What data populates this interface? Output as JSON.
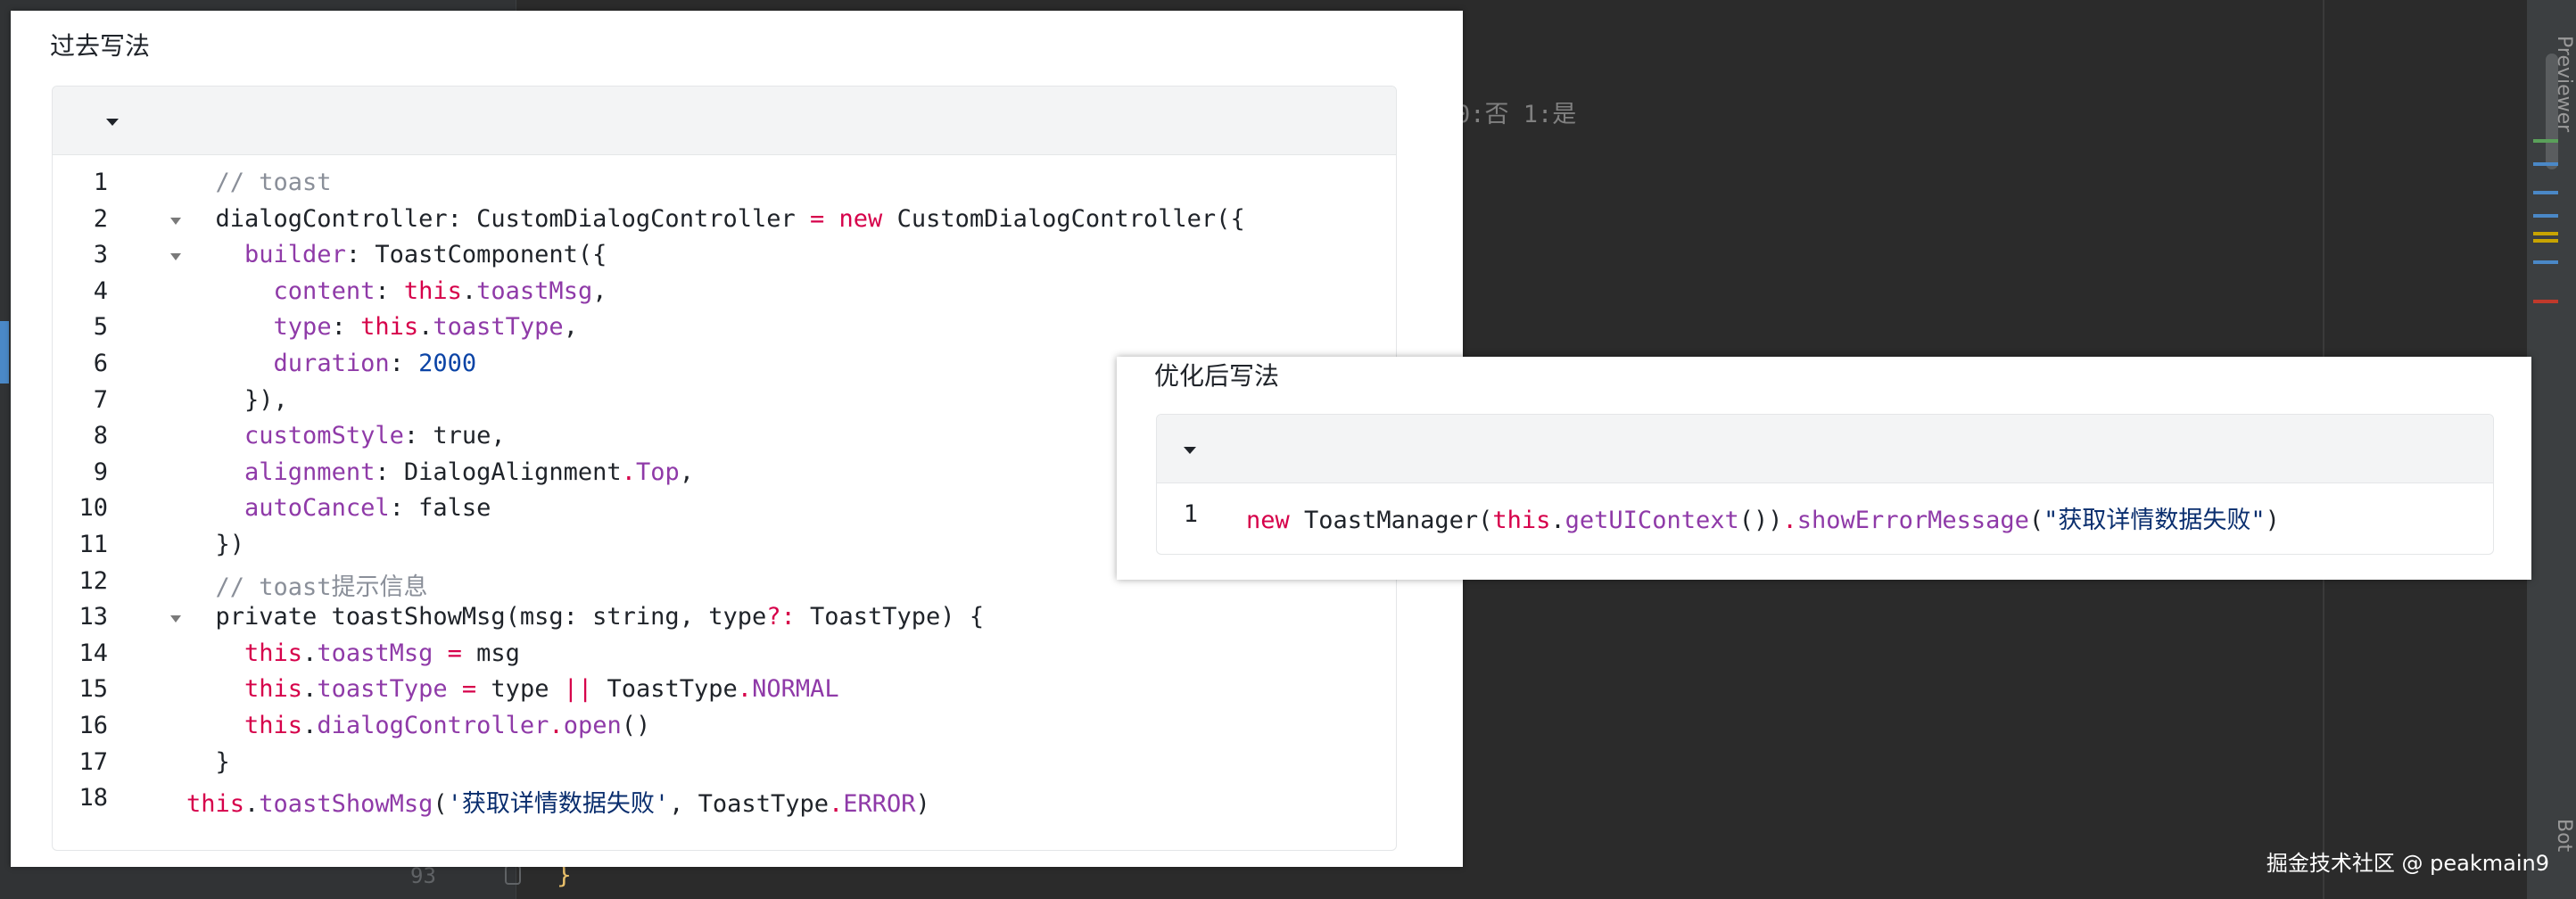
{
  "ide": {
    "bottom_line_number": "93",
    "bottom_brace": "}",
    "comment_fragment": "0:否 1:是",
    "right_sidebar_label": "Previewer",
    "right_sidebar_label2": "Bot"
  },
  "left_panel": {
    "title": "过去写法",
    "lines": [
      {
        "n": "1",
        "fold": false,
        "indent": "  ",
        "tokens": [
          {
            "t": "// toast",
            "c": "com"
          }
        ]
      },
      {
        "n": "2",
        "fold": true,
        "indent": "  ",
        "tokens": [
          {
            "t": "dialogController: CustomDialogController ",
            "c": "plain"
          },
          {
            "t": "=",
            "c": "kw"
          },
          {
            "t": " ",
            "c": "plain"
          },
          {
            "t": "new",
            "c": "kw"
          },
          {
            "t": " CustomDialogController({",
            "c": "plain"
          }
        ]
      },
      {
        "n": "3",
        "fold": true,
        "indent": "    ",
        "tokens": [
          {
            "t": "builder",
            "c": "prop"
          },
          {
            "t": ": ToastComponent({",
            "c": "plain"
          }
        ]
      },
      {
        "n": "4",
        "fold": false,
        "indent": "      ",
        "tokens": [
          {
            "t": "content",
            "c": "prop"
          },
          {
            "t": ": ",
            "c": "plain"
          },
          {
            "t": "this",
            "c": "kw"
          },
          {
            "t": ".",
            "c": "plain"
          },
          {
            "t": "toastMsg",
            "c": "prop"
          },
          {
            "t": ",",
            "c": "plain"
          }
        ]
      },
      {
        "n": "5",
        "fold": false,
        "indent": "      ",
        "tokens": [
          {
            "t": "type",
            "c": "prop"
          },
          {
            "t": ": ",
            "c": "plain"
          },
          {
            "t": "this",
            "c": "kw"
          },
          {
            "t": ".",
            "c": "plain"
          },
          {
            "t": "toastType",
            "c": "prop"
          },
          {
            "t": ",",
            "c": "plain"
          }
        ]
      },
      {
        "n": "6",
        "fold": false,
        "indent": "      ",
        "tokens": [
          {
            "t": "duration",
            "c": "prop"
          },
          {
            "t": ": ",
            "c": "plain"
          },
          {
            "t": "2000",
            "c": "num"
          }
        ]
      },
      {
        "n": "7",
        "fold": false,
        "indent": "    ",
        "tokens": [
          {
            "t": "}),",
            "c": "plain"
          }
        ]
      },
      {
        "n": "8",
        "fold": false,
        "indent": "    ",
        "tokens": [
          {
            "t": "customStyle",
            "c": "prop"
          },
          {
            "t": ": true,",
            "c": "plain"
          }
        ]
      },
      {
        "n": "9",
        "fold": false,
        "indent": "    ",
        "tokens": [
          {
            "t": "alignment",
            "c": "prop"
          },
          {
            "t": ": DialogAlignment",
            "c": "plain"
          },
          {
            "t": ".",
            "c": "kw"
          },
          {
            "t": "Top",
            "c": "prop"
          },
          {
            "t": ",",
            "c": "plain"
          }
        ]
      },
      {
        "n": "10",
        "fold": false,
        "indent": "    ",
        "tokens": [
          {
            "t": "autoCancel",
            "c": "prop"
          },
          {
            "t": ": false",
            "c": "plain"
          }
        ]
      },
      {
        "n": "11",
        "fold": false,
        "indent": "  ",
        "tokens": [
          {
            "t": "})",
            "c": "plain"
          }
        ]
      },
      {
        "n": "12",
        "fold": false,
        "indent": "  ",
        "tokens": [
          {
            "t": "// toast提示信息",
            "c": "com"
          }
        ]
      },
      {
        "n": "13",
        "fold": true,
        "indent": "  ",
        "tokens": [
          {
            "t": "private toastShowMsg(msg: string, type",
            "c": "plain"
          },
          {
            "t": "?:",
            "c": "kw"
          },
          {
            "t": " ToastType) {",
            "c": "plain"
          }
        ]
      },
      {
        "n": "14",
        "fold": false,
        "indent": "    ",
        "tokens": [
          {
            "t": "this",
            "c": "kw"
          },
          {
            "t": ".",
            "c": "plain"
          },
          {
            "t": "toastMsg",
            "c": "prop"
          },
          {
            "t": " ",
            "c": "plain"
          },
          {
            "t": "=",
            "c": "kw"
          },
          {
            "t": " msg",
            "c": "plain"
          }
        ]
      },
      {
        "n": "15",
        "fold": false,
        "indent": "    ",
        "tokens": [
          {
            "t": "this",
            "c": "kw"
          },
          {
            "t": ".",
            "c": "plain"
          },
          {
            "t": "toastType",
            "c": "prop"
          },
          {
            "t": " ",
            "c": "plain"
          },
          {
            "t": "=",
            "c": "kw"
          },
          {
            "t": " type ",
            "c": "plain"
          },
          {
            "t": "||",
            "c": "kw"
          },
          {
            "t": " ToastType",
            "c": "plain"
          },
          {
            "t": ".",
            "c": "kw"
          },
          {
            "t": "NORMAL",
            "c": "prop"
          }
        ]
      },
      {
        "n": "16",
        "fold": false,
        "indent": "    ",
        "tokens": [
          {
            "t": "this",
            "c": "kw"
          },
          {
            "t": ".",
            "c": "plain"
          },
          {
            "t": "dialogController",
            "c": "prop"
          },
          {
            "t": ".",
            "c": "kw"
          },
          {
            "t": "open",
            "c": "prop"
          },
          {
            "t": "()",
            "c": "plain"
          }
        ]
      },
      {
        "n": "17",
        "fold": false,
        "indent": "  ",
        "tokens": [
          {
            "t": "}",
            "c": "plain"
          }
        ]
      },
      {
        "n": "18",
        "fold": false,
        "indent": "",
        "tokens": [
          {
            "t": "this",
            "c": "kw"
          },
          {
            "t": ".",
            "c": "plain"
          },
          {
            "t": "toastShowMsg",
            "c": "prop"
          },
          {
            "t": "(",
            "c": "plain"
          },
          {
            "t": "'获取详情数据失败'",
            "c": "str"
          },
          {
            "t": ", ToastType",
            "c": "plain"
          },
          {
            "t": ".",
            "c": "kw"
          },
          {
            "t": "ERROR",
            "c": "prop"
          },
          {
            "t": ")",
            "c": "plain"
          }
        ]
      }
    ]
  },
  "right_panel": {
    "title": "优化后写法",
    "lines": [
      {
        "n": "1",
        "fold": false,
        "indent": "",
        "tokens": [
          {
            "t": "new",
            "c": "kw"
          },
          {
            "t": " ToastManager(",
            "c": "plain"
          },
          {
            "t": "this",
            "c": "kw"
          },
          {
            "t": ".",
            "c": "plain"
          },
          {
            "t": "getUIContext",
            "c": "prop"
          },
          {
            "t": "())",
            "c": "plain"
          },
          {
            "t": ".",
            "c": "kw"
          },
          {
            "t": "showErrorMessage",
            "c": "prop"
          },
          {
            "t": "(",
            "c": "plain"
          },
          {
            "t": "\"获取详情数据失败\"",
            "c": "str"
          },
          {
            "t": ")",
            "c": "plain"
          }
        ]
      }
    ]
  },
  "watermark": "掘金技术社区 @ peakmain9",
  "colors": {
    "keyword": "#d6004a",
    "property": "#8f3aa8",
    "number": "#0b44a6",
    "comment": "#8a8f99",
    "ide_bg": "#2b2b2b"
  }
}
